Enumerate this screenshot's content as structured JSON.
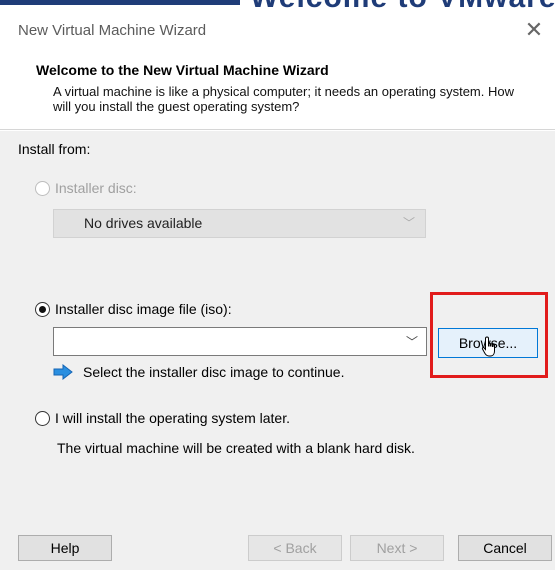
{
  "background": {
    "text": "Welcome to VMware"
  },
  "window": {
    "title": "New Virtual Machine Wizard",
    "close_icon": "close-icon"
  },
  "header": {
    "heading": "Welcome to the New Virtual Machine Wizard",
    "description": "A virtual machine is like a physical computer; it needs an operating system. How will you install the guest operating system?"
  },
  "install": {
    "label": "Install from:",
    "options": [
      {
        "label": "Installer disc:",
        "selected": false,
        "enabled": false
      },
      {
        "label": "Installer disc image file (iso):",
        "selected": true,
        "enabled": true
      },
      {
        "label": "I will install the operating system later.",
        "selected": false,
        "enabled": true
      }
    ],
    "disc_combo_value": "No drives available",
    "iso_combo_value": "",
    "browse_label": "Browse...",
    "hint": "Select the installer disc image to continue.",
    "later_description": "The virtual machine will be created with a blank hard disk."
  },
  "footer": {
    "help": "Help",
    "back": "< Back",
    "next": "Next >",
    "cancel": "Cancel"
  },
  "colors": {
    "highlight": "#e11b1b",
    "accent": "#0078d7",
    "hint_arrow": "#2a8fe0",
    "background_banner": "#1f3c78"
  }
}
